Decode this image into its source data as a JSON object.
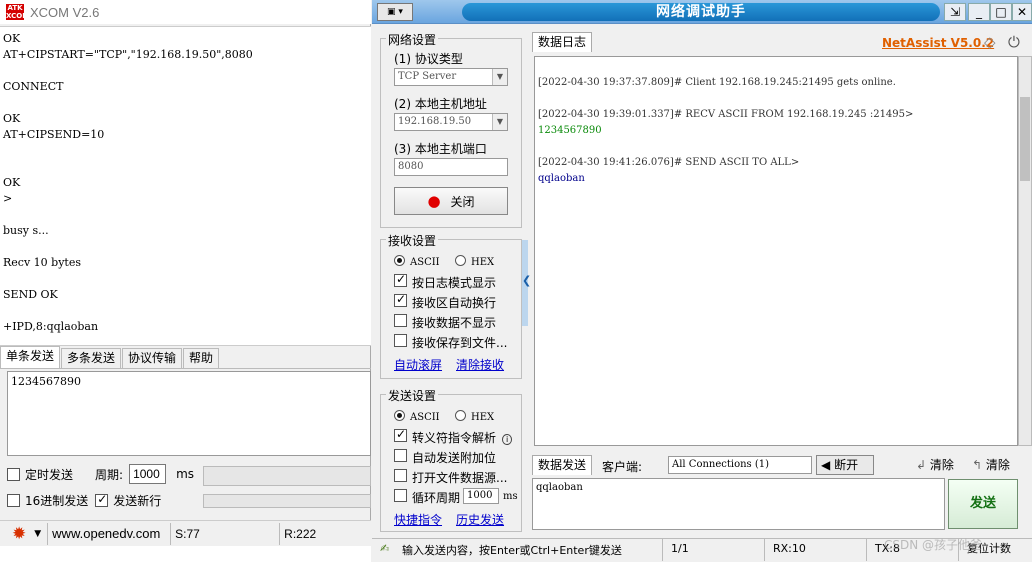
{
  "xcom": {
    "logo": "ATK XCOM",
    "title": "XCOM V2.6",
    "log_lines": [
      "OK",
      "AT+CIPSTART=\"TCP\",\"192.168.19.50\",8080",
      "",
      "CONNECT",
      "",
      "OK",
      "AT+CIPSEND=10",
      "",
      "",
      "OK",
      ">",
      "",
      "busy s...",
      "",
      "Recv 10 bytes",
      "",
      "SEND OK",
      "",
      "+IPD,8:qqlaoban"
    ],
    "tabs": [
      "单条发送",
      "多条发送",
      "协议传输",
      "帮助"
    ],
    "send_text": "1234567890",
    "timed_send_label": "定时发送",
    "period_label": "周期:",
    "period_value": "1000",
    "period_unit": "ms",
    "hex_send_label": "16进制发送",
    "send_newline_label": "发送新行",
    "website": "www.openedv.com",
    "s_count": "S:77",
    "r_count": "R:222"
  },
  "net": {
    "menu_btn": "▣ ▾",
    "title": "网络调试助手",
    "net_settings": "网络设置",
    "protocol_label": "(1) 协议类型",
    "protocol_value": "TCP Server",
    "host_label": "(2) 本地主机地址",
    "host_value": "192.168.19.50",
    "port_label": "(3) 本地主机端口",
    "port_value": "8080",
    "close_btn": "关闭",
    "recv_settings": "接收设置",
    "ascii": "ASCII",
    "hex": "HEX",
    "recv_opts": [
      "按日志模式显示",
      "接收区自动换行",
      "接收数据不显示",
      "接收保存到文件..."
    ],
    "auto_scroll": "自动滚屏",
    "clear_recv": "清除接收",
    "send_settings": "发送设置",
    "send_opts": [
      "转义符指令解析",
      "自动发送附加位",
      "打开文件数据源...",
      "循环周期"
    ],
    "loop_value": "1000",
    "loop_unit": "ms",
    "quick_cmd": "快捷指令",
    "history_send": "历史发送",
    "data_log_tab": "数据日志",
    "brand": "NetAssist V5.0.2",
    "log": [
      {
        "text": "[2022-04-30 19:37:37.809]# Client 192.168.19.245:21495 gets online.",
        "color": "#333333"
      },
      {
        "text": "",
        "color": "#333333"
      },
      {
        "text": "[2022-04-30 19:39:01.337]# RECV ASCII FROM 192.168.19.245 :21495>",
        "color": "#333333"
      },
      {
        "text": "1234567890",
        "color": "#0a8a0a"
      },
      {
        "text": "",
        "color": "#333333"
      },
      {
        "text": "[2022-04-30 19:41:26.076]# SEND ASCII TO ALL>",
        "color": "#333333"
      },
      {
        "text": "qqlaoban",
        "color": "#00008b"
      }
    ],
    "data_send_tab": "数据发送",
    "client_label": "客户端:",
    "client_value": "All Connections (1)",
    "disconnect_btn": "断开",
    "clear1": "清除",
    "clear2": "清除",
    "send_text": "qqlaoban",
    "send_btn": "发送",
    "status_hint": "输入发送内容，按Enter或Ctrl+Enter键发送",
    "page": "1/1",
    "rx": "RX:10",
    "tx": "TX:8",
    "reset_count": "复位计数",
    "watermark": "CSDN @孩子他爸",
    "accent_color": "#1270b8",
    "brand_color": "#e06000"
  }
}
